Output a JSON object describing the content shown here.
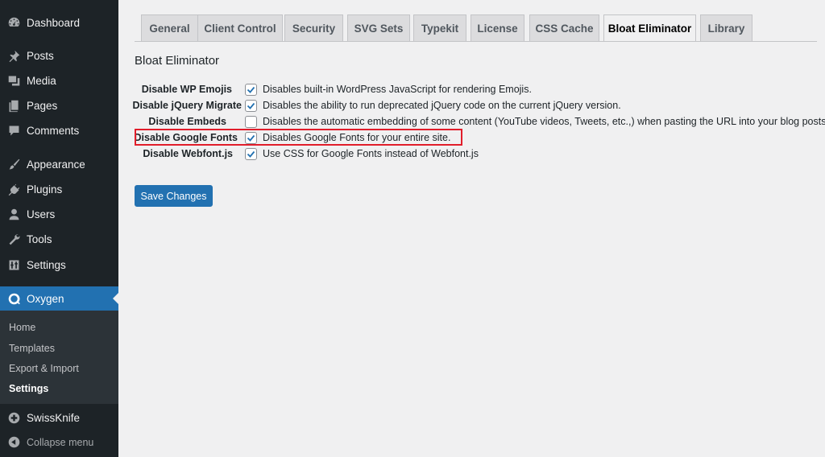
{
  "sidebar": {
    "items": [
      {
        "label": "Dashboard",
        "icon": "dashboard-icon"
      },
      {
        "label": "Posts",
        "icon": "pin-icon"
      },
      {
        "label": "Media",
        "icon": "media-icon"
      },
      {
        "label": "Pages",
        "icon": "pages-icon"
      },
      {
        "label": "Comments",
        "icon": "comment-icon"
      },
      {
        "label": "Appearance",
        "icon": "brush-icon"
      },
      {
        "label": "Plugins",
        "icon": "plug-icon"
      },
      {
        "label": "Users",
        "icon": "user-icon"
      },
      {
        "label": "Tools",
        "icon": "wrench-icon"
      },
      {
        "label": "Settings",
        "icon": "sliders-icon"
      },
      {
        "label": "Oxygen",
        "icon": "oxygen-icon"
      },
      {
        "label": "SwissKnife",
        "icon": "plus-circle-icon"
      },
      {
        "label": "Collapse menu",
        "icon": "collapse-icon"
      }
    ],
    "submenu": [
      "Home",
      "Templates",
      "Export & Import",
      "Settings"
    ]
  },
  "tabs": [
    "General",
    "Client Control",
    "Security",
    "SVG Sets",
    "Typekit",
    "License",
    "CSS Cache",
    "Bloat Eliminator",
    "Library"
  ],
  "active_tab": "Bloat Eliminator",
  "section_title": "Bloat Eliminator",
  "options": [
    {
      "label": "Disable WP Emojis",
      "checked": true,
      "description": "Disables built-in WordPress JavaScript for rendering Emojis."
    },
    {
      "label": "Disable jQuery Migrate",
      "checked": true,
      "description": "Disables the ability to run deprecated jQuery code on the current jQuery version."
    },
    {
      "label": "Disable Embeds",
      "checked": false,
      "description": "Disables the automatic embedding of some content (YouTube videos, Tweets, etc.,) when pasting the URL into your blog posts."
    },
    {
      "label": "Disable Google Fonts",
      "checked": true,
      "description": "Disables Google Fonts for your entire site."
    },
    {
      "label": "Disable Webfont.js",
      "checked": true,
      "description": "Use CSS for Google Fonts instead of Webfont.js"
    }
  ],
  "save_label": "Save Changes",
  "colors": {
    "accent": "#2271b1",
    "sidebar": "#1d2327",
    "highlight": "#e11d2a"
  }
}
